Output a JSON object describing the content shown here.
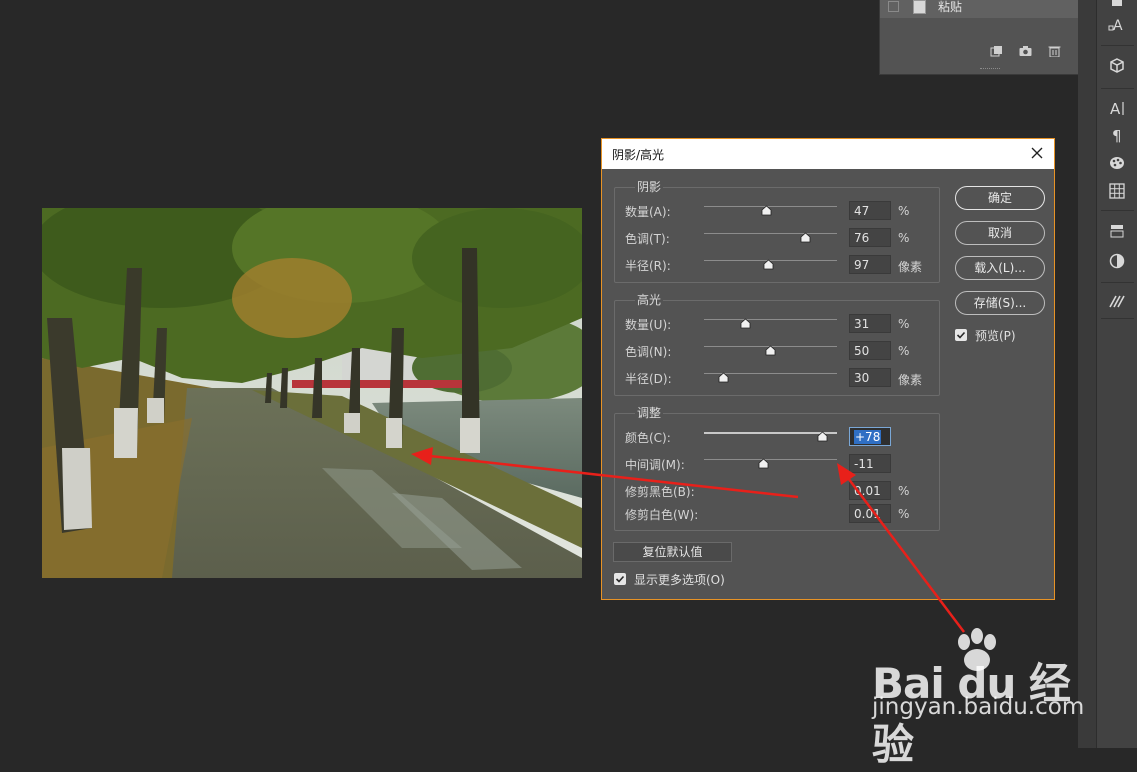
{
  "history_panel": {
    "item_label": "粘贴"
  },
  "dialog": {
    "title": "阴影/高光",
    "shadows": {
      "title": "阴影",
      "rows": [
        {
          "label": "数量(A):",
          "value": "47",
          "unit": "%",
          "slider_fraction": 0.47
        },
        {
          "label": "色调(T):",
          "value": "76",
          "unit": "%",
          "slider_fraction": 0.76
        },
        {
          "label": "半径(R):",
          "value": "97",
          "unit": "像素",
          "slider_fraction": 0.485
        }
      ]
    },
    "highlights": {
      "title": "高光",
      "rows": [
        {
          "label": "数量(U):",
          "value": "31",
          "unit": "%",
          "slider_fraction": 0.31
        },
        {
          "label": "色调(N):",
          "value": "50",
          "unit": "%",
          "slider_fraction": 0.5
        },
        {
          "label": "半径(D):",
          "value": "30",
          "unit": "像素",
          "slider_fraction": 0.15
        }
      ]
    },
    "adjustments": {
      "title": "调整",
      "rows": [
        {
          "label": "颜色(C):",
          "value": "+78",
          "unit": "",
          "slider_fraction": 0.89
        },
        {
          "label": "中间调(M):",
          "value": "-11",
          "unit": "",
          "slider_fraction": 0.445
        },
        {
          "label": "修剪黑色(B):",
          "value": "0.01",
          "unit": "%"
        },
        {
          "label": "修剪白色(W):",
          "value": "0.01",
          "unit": "%"
        }
      ]
    },
    "buttons": {
      "ok": "确定",
      "cancel": "取消",
      "load": "载入(L)...",
      "save": "存储(S)..."
    },
    "preview_label": "预览(P)",
    "preview_checked": true,
    "reset_label": "复位默认值",
    "show_more_label": "显示更多选项(O)",
    "show_more_checked": true
  },
  "watermark": {
    "brand": "Bai du 经验",
    "url": "jingyan.baidu.com"
  },
  "colors": {
    "canvas_bg": "#282828",
    "dialog_bg": "#535353",
    "dialog_border": "#e79326",
    "arrow": "#e8201a",
    "selection": "#2f6fc4"
  }
}
